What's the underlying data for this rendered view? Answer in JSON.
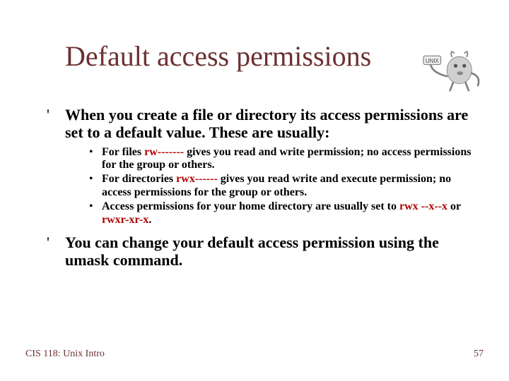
{
  "title": "Default access permissions",
  "bullets": [
    {
      "marker": "'",
      "text": "When you create a file or directory its access permissions are set to a default value. These are usually:"
    },
    {
      "marker": "'",
      "text": "You can change your default access permission using the umask command."
    }
  ],
  "subbullets": [
    {
      "marker": "•",
      "pre": "For files ",
      "perm": "rw-------",
      "post": " gives you read and write permission; no access permissions for the group or others."
    },
    {
      "marker": "•",
      "pre": "For directories ",
      "perm": "rwx------",
      "post": " gives you read write and execute permission; no access permissions for the group or others."
    },
    {
      "marker": "•",
      "pre": "Access permissions for your home directory are usually set to ",
      "perm": "rwx --x--x",
      "mid": " or ",
      "perm2": "rwxr-xr-x",
      "post2": "."
    }
  ],
  "footer": {
    "left": "CIS 118: Unix Intro",
    "right": "57"
  }
}
